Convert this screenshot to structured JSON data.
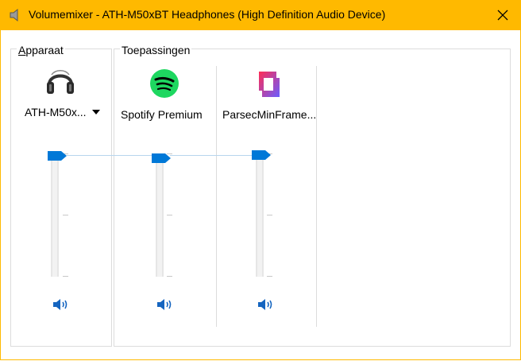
{
  "window": {
    "title": "Volumemixer - ATH-M50xBT Headphones (High Definition Audio Device)",
    "accent_color": "#ffb900"
  },
  "device_section": {
    "label_underlined": "A",
    "label_rest": "pparaat",
    "device_name": "ATH-M50x...",
    "device_icon": "headphones-icon",
    "volume_percent": 100,
    "muted": false
  },
  "apps_section": {
    "label": "Toepassingen",
    "apps": [
      {
        "name": "Spotify Premium",
        "icon": "spotify-icon",
        "volume_percent": 100,
        "muted": false
      },
      {
        "name": "ParsecMinFrame...",
        "icon": "parsec-icon",
        "volume_percent": 100,
        "muted": false
      }
    ]
  },
  "colors": {
    "thumb": "#0078d7",
    "speaker": "#1565c0",
    "spotify": "#1ed760",
    "parsec_a": "#ff2d55",
    "parsec_b": "#6a5cff"
  }
}
